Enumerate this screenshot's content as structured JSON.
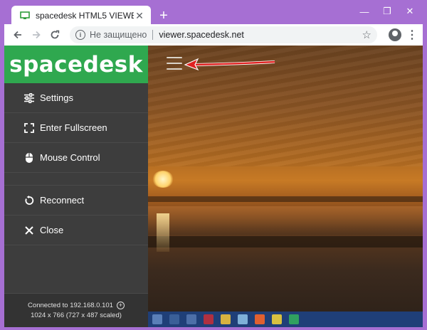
{
  "browser": {
    "tab_title": "spacedesk HTML5 VIEWER",
    "tab_close": "✕",
    "new_tab": "+",
    "window_controls": {
      "minimize": "—",
      "restore": "❐",
      "close": "✕"
    },
    "security_label": "Не защищено",
    "url": "viewer.spacedesk.net",
    "bookmark_icon": "star-icon",
    "menu_icon": "⋮"
  },
  "sidebar": {
    "brand": "spacedesk",
    "items": [
      {
        "label": "Settings",
        "icon": "sliders-icon"
      },
      {
        "label": "Enter Fullscreen",
        "icon": "fullscreen-icon"
      },
      {
        "label": "Mouse Control",
        "icon": "mouse-icon"
      },
      {
        "label": "Reconnect",
        "icon": "reconnect-icon"
      },
      {
        "label": "Close",
        "icon": "close-icon"
      }
    ],
    "status_line1": "Connected to 192.168.0.101",
    "status_line2": "1024 x 766 (727 x 487 scaled)"
  },
  "colors": {
    "window_frame": "#a66fd3",
    "brand_green": "#2fa84f",
    "sidebar_bg": "#3d3d3d",
    "annotation_arrow": "#e02020"
  }
}
